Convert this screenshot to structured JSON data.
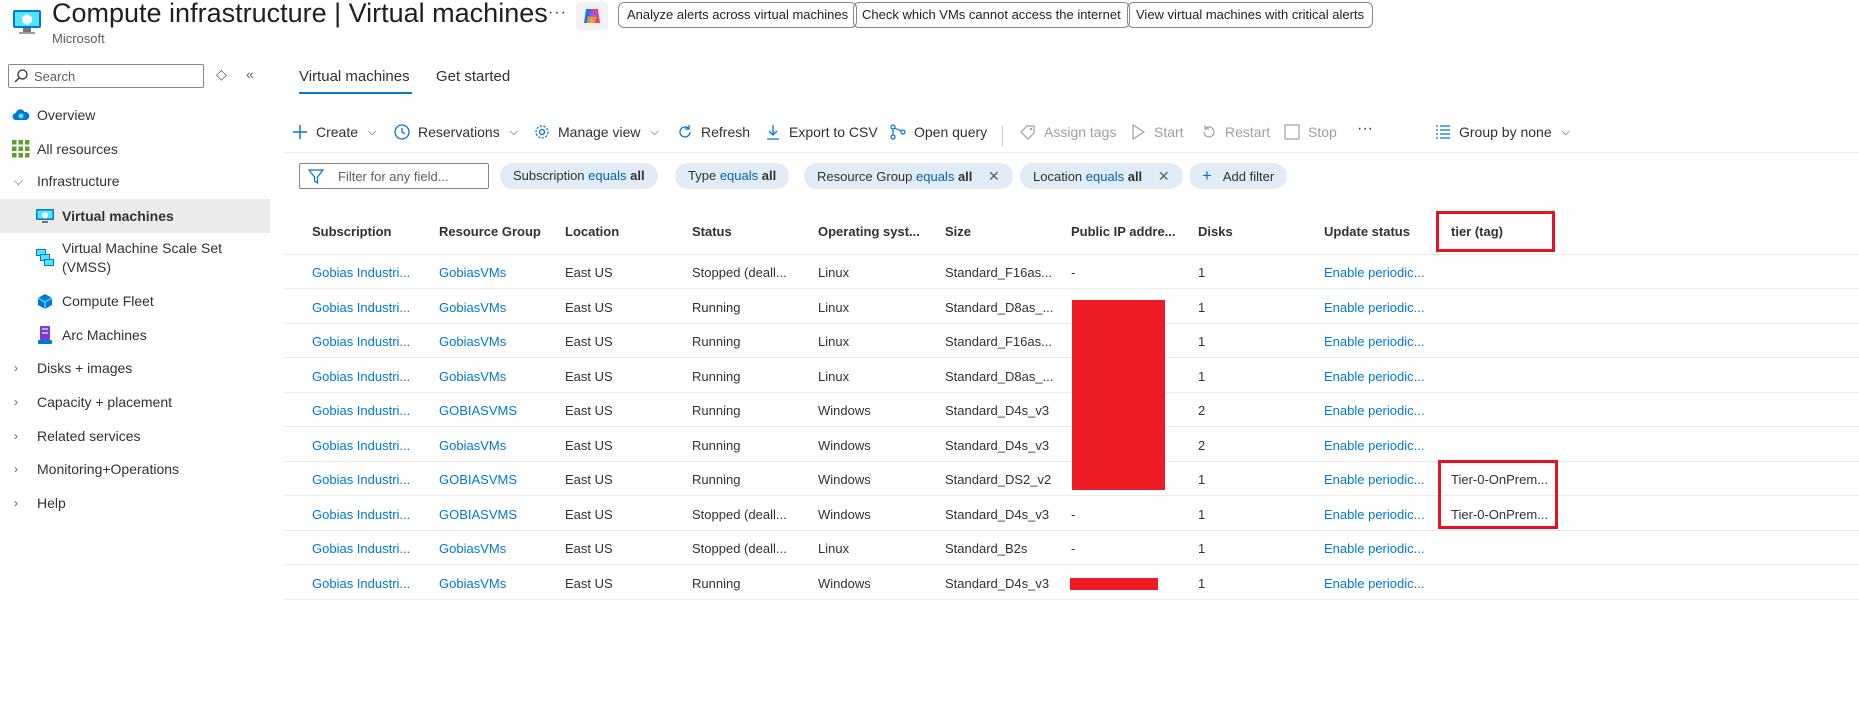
{
  "header": {
    "title": "Compute infrastructure | Virtual machines",
    "subtitle": "Microsoft",
    "more": "···",
    "copilot_prompts": [
      "Analyze alerts across virtual machines",
      "Check which VMs cannot access the internet",
      "View virtual machines with critical alerts"
    ]
  },
  "sidebar": {
    "search_placeholder": "Search",
    "items": [
      {
        "label": "Overview"
      },
      {
        "label": "All resources"
      },
      {
        "label": "Infrastructure"
      },
      {
        "label": "Virtual machines"
      },
      {
        "label": "Virtual Machine Scale Set (VMSS)"
      },
      {
        "label": "Compute Fleet"
      },
      {
        "label": "Arc Machines"
      },
      {
        "label": "Disks + images"
      },
      {
        "label": "Capacity + placement"
      },
      {
        "label": "Related services"
      },
      {
        "label": "Monitoring+Operations"
      },
      {
        "label": "Help"
      }
    ]
  },
  "tabs": [
    {
      "label": "Virtual machines"
    },
    {
      "label": "Get started"
    }
  ],
  "toolbar": {
    "create": "Create",
    "reservations": "Reservations",
    "manage_view": "Manage view",
    "refresh": "Refresh",
    "export_csv": "Export to CSV",
    "open_query": "Open query",
    "assign_tags": "Assign tags",
    "start": "Start",
    "restart": "Restart",
    "stop": "Stop",
    "more": "···",
    "group_by": "Group by none"
  },
  "filters": {
    "placeholder": "Filter for any field...",
    "equals": "equals",
    "chips": [
      {
        "field": "Subscription",
        "value": "all"
      },
      {
        "field": "Type",
        "value": "all"
      },
      {
        "field": "Resource Group",
        "value": "all"
      },
      {
        "field": "Location",
        "value": "all"
      }
    ],
    "add_filter": "Add filter"
  },
  "table": {
    "columns": [
      "Subscription",
      "Resource Group",
      "Location",
      "Status",
      "Operating syst...",
      "Size",
      "Public IP addre...",
      "Disks",
      "Update status",
      "tier (tag)"
    ],
    "rows": [
      [
        "Gobias Industri...",
        "GobiasVMs",
        "East US",
        "Stopped (deall...",
        "Linux",
        "Standard_F16as...",
        "-",
        "1",
        "Enable periodic...",
        ""
      ],
      [
        "Gobias Industri...",
        "GobiasVMs",
        "East US",
        "Running",
        "Linux",
        "Standard_D8as_...",
        "",
        "1",
        "Enable periodic...",
        ""
      ],
      [
        "Gobias Industri...",
        "GobiasVMs",
        "East US",
        "Running",
        "Linux",
        "Standard_F16as...",
        "",
        "1",
        "Enable periodic...",
        ""
      ],
      [
        "Gobias Industri...",
        "GobiasVMs",
        "East US",
        "Running",
        "Linux",
        "Standard_D8as_...",
        "",
        "1",
        "Enable periodic...",
        ""
      ],
      [
        "Gobias Industri...",
        "GOBIASVMS",
        "East US",
        "Running",
        "Windows",
        "Standard_D4s_v3",
        "",
        "2",
        "Enable periodic...",
        ""
      ],
      [
        "Gobias Industri...",
        "GobiasVMs",
        "East US",
        "Running",
        "Windows",
        "Standard_D4s_v3",
        "",
        "2",
        "Enable periodic...",
        ""
      ],
      [
        "Gobias Industri...",
        "GOBIASVMS",
        "East US",
        "Running",
        "Windows",
        "Standard_DS2_v2",
        "",
        "1",
        "Enable periodic...",
        "Tier-0-OnPrem..."
      ],
      [
        "Gobias Industri...",
        "GOBIASVMS",
        "East US",
        "Stopped (deall...",
        "Windows",
        "Standard_D4s_v3",
        "-",
        "1",
        "Enable periodic...",
        "Tier-0-OnPrem..."
      ],
      [
        "Gobias Industri...",
        "GobiasVMs",
        "East US",
        "Stopped (deall...",
        "Linux",
        "Standard_B2s",
        "-",
        "1",
        "Enable periodic...",
        ""
      ],
      [
        "Gobias Industri...",
        "GobiasVMs",
        "East US",
        "Running",
        "Windows",
        "Standard_D4s_v3",
        "",
        "1",
        "Enable periodic...",
        ""
      ]
    ]
  },
  "colors": {
    "accent": "#0078d4",
    "highlight": "#e81123",
    "redaction": "#ed1c24"
  }
}
